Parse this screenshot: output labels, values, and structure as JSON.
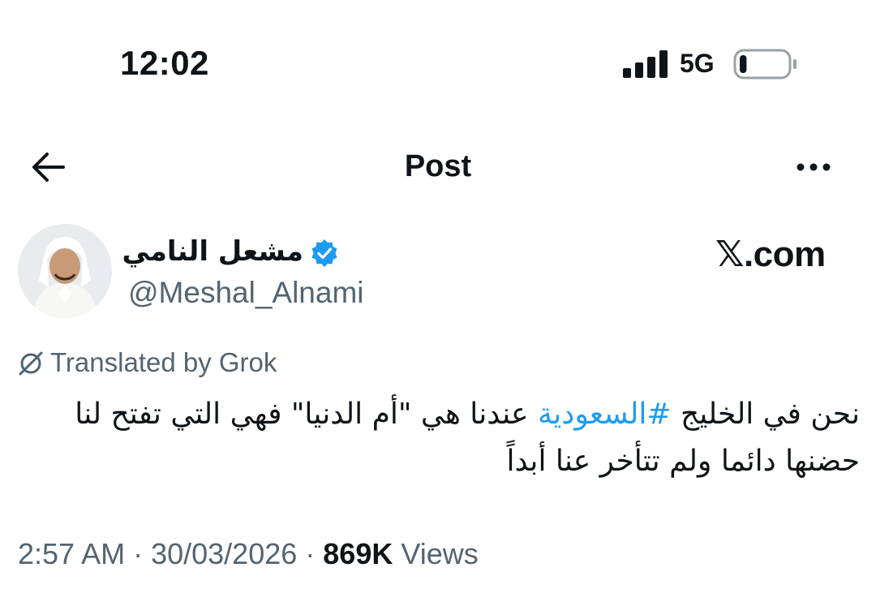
{
  "status_bar": {
    "time": "12:02",
    "network": "5G",
    "signal_bars": 4,
    "battery_level": 0.15
  },
  "header": {
    "title": "Post",
    "back_icon": "arrow-left-icon",
    "more_icon": "more-horizontal-icon"
  },
  "author": {
    "name": "مشعل النامي",
    "handle": "@Meshal_Alnami",
    "verified": true,
    "verified_color": "#1d9bf0"
  },
  "watermark": "𝕏.com",
  "translation_note": "Translated by Grok",
  "post": {
    "text_before": "نحن في الخليج ",
    "hashtag": "#السعودية",
    "text_after": " عندنا هي \"أم الدنيا\" فهي التي تفتح لنا حضنها دائما ولم تتأخر عنا أبداً"
  },
  "meta": {
    "time": "2:57 AM",
    "separator": " · ",
    "date": "30/03/2026",
    "views_count": "869K",
    "views_label": " Views"
  },
  "colors": {
    "text": "#0f1419",
    "secondary": "#536471",
    "accent": "#1d9bf0"
  }
}
